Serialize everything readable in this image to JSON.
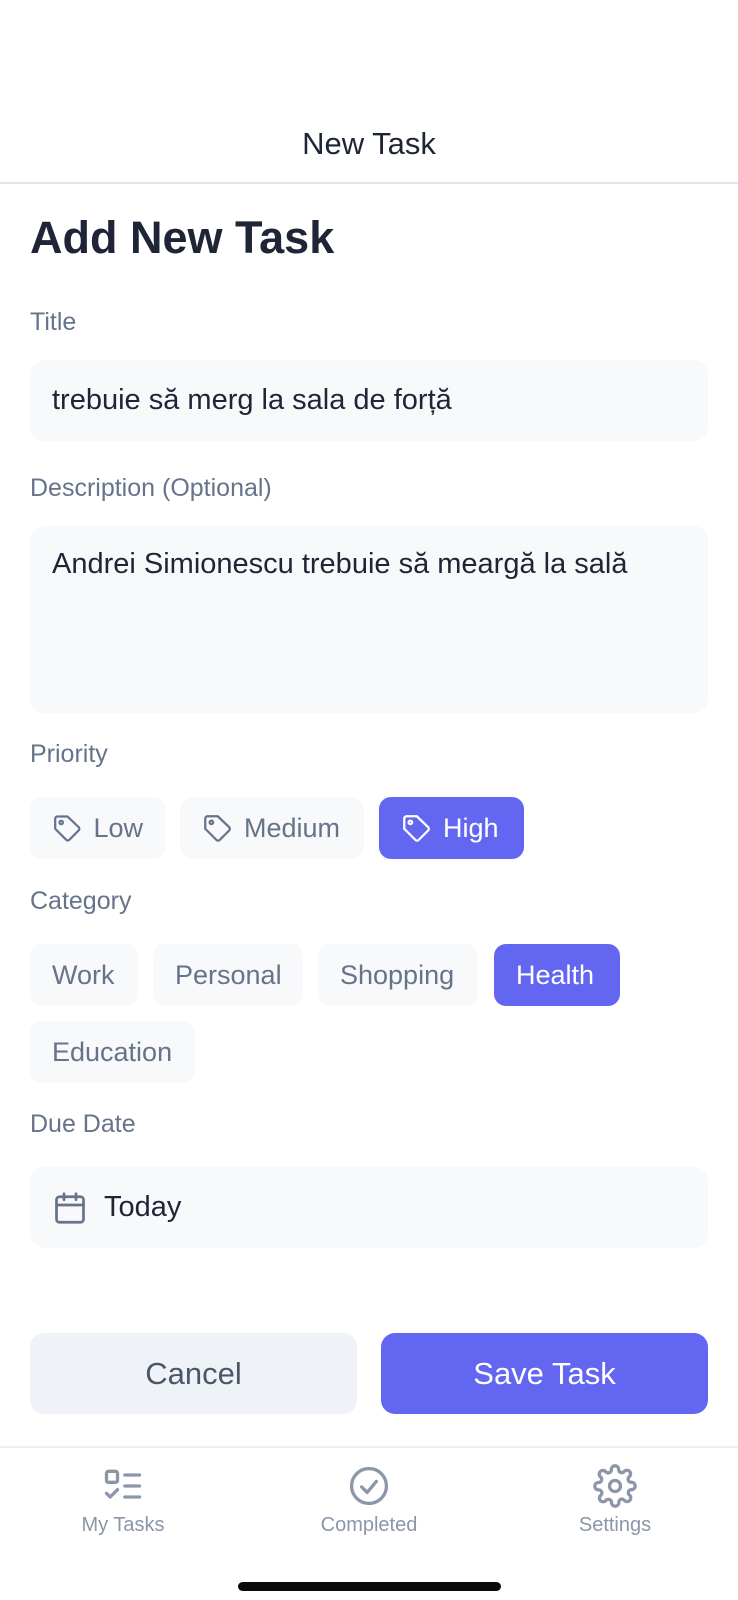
{
  "header": {
    "title": "New Task"
  },
  "page_title": "Add New Task",
  "form": {
    "title_label": "Title",
    "title_value": "trebuie să merg la sala de forță",
    "description_label": "Description (Optional)",
    "description_value": "Andrei Simionescu trebuie să meargă la sală",
    "priority_label": "Priority",
    "priorities": [
      {
        "label": "Low",
        "selected": false
      },
      {
        "label": "Medium",
        "selected": false
      },
      {
        "label": "High",
        "selected": true
      }
    ],
    "category_label": "Category",
    "categories": [
      {
        "label": "Work",
        "selected": false
      },
      {
        "label": "Personal",
        "selected": false
      },
      {
        "label": "Shopping",
        "selected": false
      },
      {
        "label": "Health",
        "selected": true
      },
      {
        "label": "Education",
        "selected": false
      }
    ],
    "due_date_label": "Due Date",
    "due_date_value": "Today"
  },
  "actions": {
    "cancel_label": "Cancel",
    "save_label": "Save Task"
  },
  "tabbar": {
    "items": [
      {
        "label": "My Tasks",
        "icon": "list-check-icon"
      },
      {
        "label": "Completed",
        "icon": "check-circle-icon"
      },
      {
        "label": "Settings",
        "icon": "gear-icon"
      }
    ]
  },
  "colors": {
    "accent": "#6366f1",
    "label": "#66738a",
    "text": "#1e2537",
    "field_bg": "#f8f9fb",
    "cancel_bg": "#eff2f6"
  }
}
